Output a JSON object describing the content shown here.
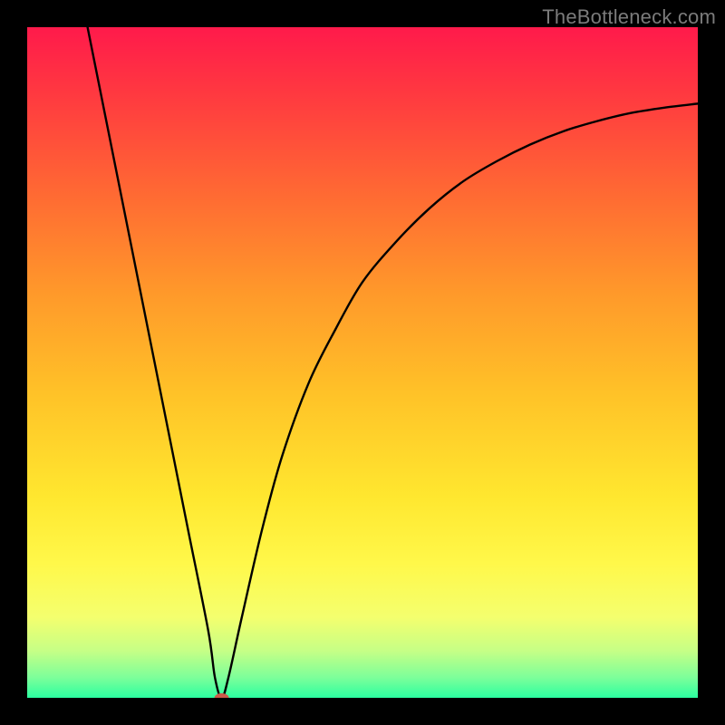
{
  "watermark": "TheBottleneck.com",
  "chart_data": {
    "type": "line",
    "title": "",
    "xlabel": "",
    "ylabel": "",
    "xlim": [
      0,
      100
    ],
    "ylim": [
      0,
      100
    ],
    "background_gradient": {
      "stops": [
        {
          "offset": 0.0,
          "color": "#ff1a4b"
        },
        {
          "offset": 0.1,
          "color": "#ff3940"
        },
        {
          "offset": 0.25,
          "color": "#ff6a33"
        },
        {
          "offset": 0.4,
          "color": "#ff9a2a"
        },
        {
          "offset": 0.55,
          "color": "#ffc328"
        },
        {
          "offset": 0.7,
          "color": "#ffe72f"
        },
        {
          "offset": 0.8,
          "color": "#fff84a"
        },
        {
          "offset": 0.88,
          "color": "#f4ff6e"
        },
        {
          "offset": 0.93,
          "color": "#c6ff86"
        },
        {
          "offset": 0.97,
          "color": "#7cff9a"
        },
        {
          "offset": 1.0,
          "color": "#2bffa0"
        }
      ]
    },
    "series": [
      {
        "name": "bottleneck-curve",
        "color": "#000000",
        "stroke_width": 2.4,
        "x": [
          9,
          12,
          15,
          18,
          21,
          24,
          27,
          28,
          29,
          30,
          32,
          35,
          38,
          42,
          46,
          50,
          55,
          60,
          65,
          70,
          75,
          80,
          85,
          90,
          95,
          100
        ],
        "y": [
          100,
          85,
          70,
          55,
          40,
          25,
          10,
          3,
          0,
          3,
          12,
          25,
          36,
          47,
          55,
          62,
          68,
          73,
          77,
          80,
          82.5,
          84.5,
          86,
          87.2,
          88,
          88.6
        ]
      }
    ],
    "marker": {
      "name": "optimal-point",
      "x": 29,
      "y": 0,
      "color": "#cc5a4a",
      "rx": 8,
      "ry": 5
    }
  }
}
